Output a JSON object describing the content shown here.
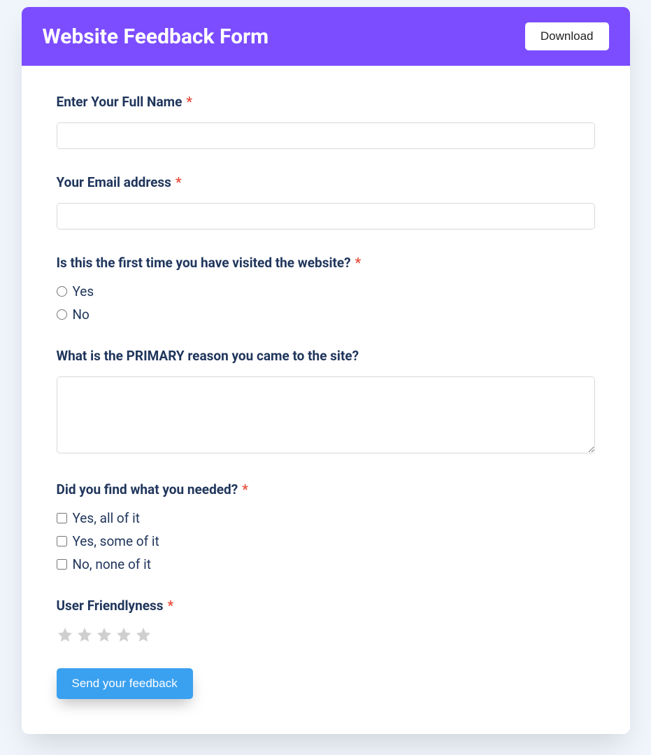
{
  "header": {
    "title": "Website Feedback Form",
    "download_label": "Download"
  },
  "fields": {
    "full_name": {
      "label": "Enter Your Full Name",
      "required": true
    },
    "email": {
      "label": "Your Email address",
      "required": true
    },
    "first_time": {
      "label": "Is this the first time you have visited the website?",
      "required": true,
      "options": [
        "Yes",
        "No"
      ]
    },
    "primary_reason": {
      "label": "What is the PRIMARY reason you came to the site?",
      "required": false
    },
    "found_needed": {
      "label": "Did you find what you needed?",
      "required": true,
      "options": [
        "Yes, all of it",
        "Yes, some of it",
        "No, none of it"
      ]
    },
    "friendliness": {
      "label": "User Friendlyness",
      "required": true,
      "stars": 5
    }
  },
  "submit_label": "Send your feedback"
}
